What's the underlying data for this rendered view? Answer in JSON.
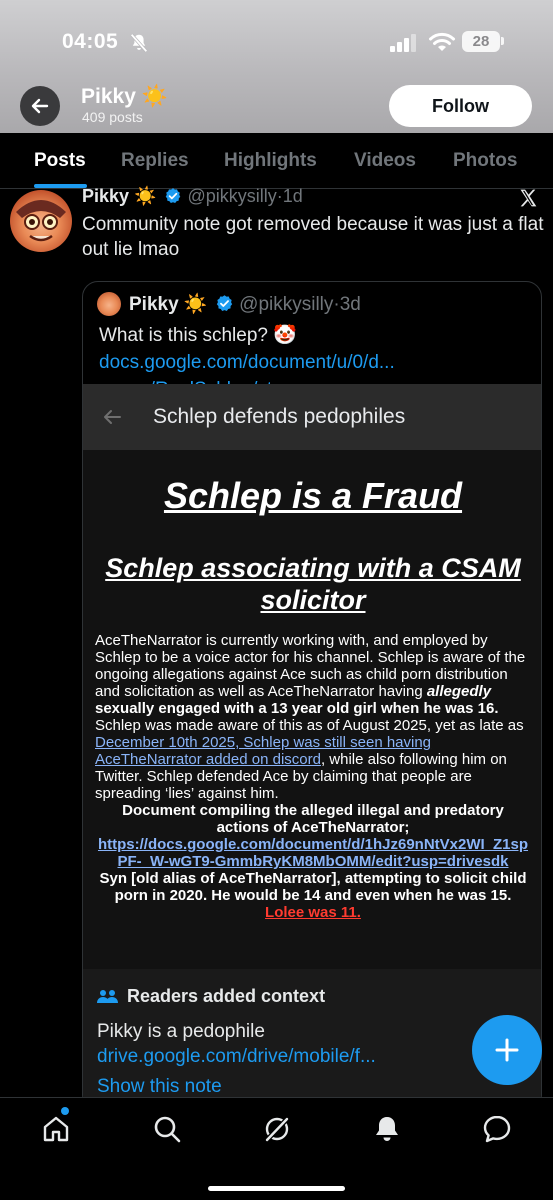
{
  "status": {
    "time": "04:05",
    "battery": "28"
  },
  "profile": {
    "name": "Pikky ☀️",
    "posts": "409 posts",
    "follow_label": "Follow"
  },
  "tabs": [
    {
      "label": "Posts"
    },
    {
      "label": "Replies"
    },
    {
      "label": "Highlights"
    },
    {
      "label": "Videos"
    },
    {
      "label": "Photos"
    }
  ],
  "post": {
    "name": "Pikky ☀️",
    "handle": "@pikkysilly",
    "time": "1d",
    "text": "Community note got removed because it was just a flat out lie lmao"
  },
  "quote": {
    "name": "Pikky ☀️",
    "handle": "@pikkysilly",
    "time": "3d",
    "text": "What is this schlep? 🤡",
    "link1": "docs.google.com/document/u/0/d...",
    "link2": "x.com/RealSchlep/sta..."
  },
  "doc": {
    "topbar_title": "Schlep defends pedophiles",
    "title": "Schlep is a Fraud",
    "heading": "Schlep associating with a CSAM solicitor",
    "para1_a": "AceTheNarrator is currently working with, and employed by Schlep to be a voice actor for his channel. Schlep is aware of the ongoing allegations against Ace such as child porn distribution and solicitation as well as AceTheNarrator having ",
    "para1_em": "allegedly",
    "para1_b": " sexually engaged with a 13 year old girl when he was 16.",
    "para1_c": " Schlep was made aware of this as of August 2025, yet as late as ",
    "para1_link": "December 10th 2025, Schlep was still seen having AceTheNarrator added on discord",
    "para1_d": ", while also following him on Twitter. Schlep defended Ace by claiming that people are spreading ‘lies’ against him.",
    "compile_heading": "Document compiling the alleged illegal and predatory actions of AceTheNarrator;",
    "compile_link": "https://docs.google.com/document/d/1hJz69nNtVx2WI_Z1spPF-_W-wGT9-GmmbRyKM8MbOMM/edit?usp=drivesdk",
    "syn_text": "Syn [old alias of AceTheNarrator], attempting to solicit child porn in 2020. He would be 14 and even when he was 15. ",
    "syn_red": "Lolee was 11."
  },
  "note": {
    "heading": "Readers added context",
    "text": "Pikky is a pedophile",
    "link": "drive.google.com/drive/mobile/f...",
    "show": "Show this note"
  }
}
